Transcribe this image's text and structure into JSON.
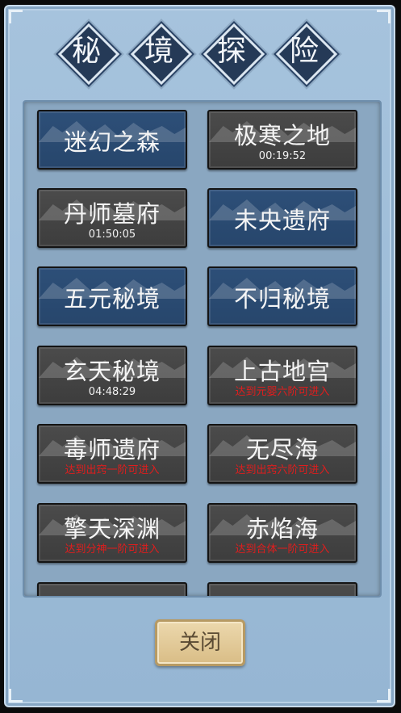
{
  "title_chars": [
    "秘",
    "境",
    "探",
    "险"
  ],
  "tiles": [
    {
      "name": "迷幻之森",
      "sub": "",
      "sub_type": "none",
      "style": "blue"
    },
    {
      "name": "极寒之地",
      "sub": "00:19:52",
      "sub_type": "timer",
      "style": "gray"
    },
    {
      "name": "丹师墓府",
      "sub": "01:50:05",
      "sub_type": "timer",
      "style": "gray"
    },
    {
      "name": "未央遗府",
      "sub": "",
      "sub_type": "none",
      "style": "blue"
    },
    {
      "name": "五元秘境",
      "sub": "",
      "sub_type": "none",
      "style": "blue"
    },
    {
      "name": "不归秘境",
      "sub": "",
      "sub_type": "none",
      "style": "blue"
    },
    {
      "name": "玄天秘境",
      "sub": "04:48:29",
      "sub_type": "timer",
      "style": "gray"
    },
    {
      "name": "上古地宫",
      "sub": "达到元婴六阶可进入",
      "sub_type": "req",
      "style": "gray"
    },
    {
      "name": "毒师遗府",
      "sub": "达到出窍一阶可进入",
      "sub_type": "req",
      "style": "gray"
    },
    {
      "name": "无尽海",
      "sub": "达到出窍六阶可进入",
      "sub_type": "req",
      "style": "gray"
    },
    {
      "name": "擎天深渊",
      "sub": "达到分神一阶可进入",
      "sub_type": "req",
      "style": "gray"
    },
    {
      "name": "赤焰海",
      "sub": "达到合体一阶可进入",
      "sub_type": "req",
      "style": "gray"
    }
  ],
  "close_button": {
    "label": "关闭"
  },
  "colors": {
    "tile_blue": "#2d4f78",
    "tile_gray": "#444444",
    "requirement_text": "#e01d1d",
    "close_button": "#e3cb98"
  }
}
